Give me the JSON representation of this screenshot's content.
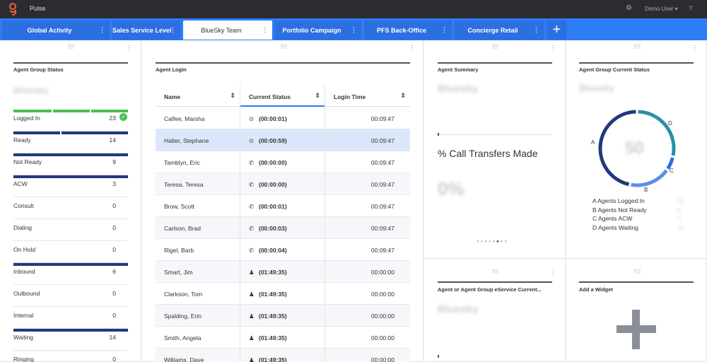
{
  "app": {
    "title": "Pulse",
    "user": "Demo User ▾",
    "help": "?"
  },
  "tabs": [
    {
      "label": "Global Activity",
      "active": false
    },
    {
      "label": "Sales Service Level",
      "active": false
    },
    {
      "label": "BlueSky Team",
      "active": true
    },
    {
      "label": "Portfolio Campaign",
      "active": false
    },
    {
      "label": "PFS Back-Office",
      "active": false
    },
    {
      "label": "Concierge Retail",
      "active": false
    }
  ],
  "tab_menu_glyph": "⋮",
  "add_tab_label": "+",
  "agent_group_status": {
    "title": "Agent Group Status",
    "group": "Bluesky",
    "rows": [
      {
        "label": "Logged In",
        "value": "23",
        "bar": 1.0,
        "color": "#4cbf4f"
      },
      {
        "label": "Ready",
        "value": "14",
        "bar": 1.0,
        "color": "#1f3a7a"
      },
      {
        "label": "Not Ready",
        "value": "9",
        "bar": 1.0,
        "color": "#1f3a7a"
      },
      {
        "label": "ACW",
        "value": "3",
        "bar": 1.0,
        "color": "#1f3a7a"
      },
      {
        "label": "Consult",
        "value": "0",
        "bar": 0,
        "color": "#1f3a7a"
      },
      {
        "label": "Dialing",
        "value": "0",
        "bar": 0,
        "color": "#1f3a7a"
      },
      {
        "label": "On Hold",
        "value": "0",
        "bar": 0,
        "color": "#1f3a7a"
      },
      {
        "label": "Inbound",
        "value": "6",
        "bar": 1.0,
        "color": "#1f3a7a"
      },
      {
        "label": "Outbound",
        "value": "0",
        "bar": 0,
        "color": "#1f3a7a"
      },
      {
        "label": "Internal",
        "value": "0",
        "bar": 0,
        "color": "#1f3a7a"
      },
      {
        "label": "Waiting",
        "value": "14",
        "bar": 1.0,
        "color": "#1f3a7a"
      },
      {
        "label": "Ringing",
        "value": "0",
        "bar": 0,
        "color": "#1f3a7a"
      }
    ]
  },
  "agent_login": {
    "title": "Agent Login",
    "columns": [
      "Name",
      "Current Status",
      "Login Time"
    ],
    "rows": [
      {
        "name": "Calfee, Marsha",
        "icon": "target",
        "status": "(00:00:01)",
        "login": "00:09:47"
      },
      {
        "name": "Halter, Stephane",
        "icon": "target",
        "status": "(00:00:59)",
        "login": "00:09:47"
      },
      {
        "name": "Tamblyn, Eric",
        "icon": "phone",
        "status": "(00:00:00)",
        "login": "00:09:47"
      },
      {
        "name": "Teresa, Teresa",
        "icon": "phone",
        "status": "(00:00:00)",
        "login": "00:09:47"
      },
      {
        "name": "Brow, Scott",
        "icon": "phone",
        "status": "(00:00:01)",
        "login": "00:09:47"
      },
      {
        "name": "Carlson, Brad",
        "icon": "phone",
        "status": "(00:00:03)",
        "login": "00:09:47"
      },
      {
        "name": "Rigel, Barb",
        "icon": "phone",
        "status": "(00:00:04)",
        "login": "00:09:47"
      },
      {
        "name": "Smart, Jim",
        "icon": "person",
        "status": "(01:49:35)",
        "login": "00:00:00"
      },
      {
        "name": "Clarkson, Tom",
        "icon": "person",
        "status": "(01:49:35)",
        "login": "00:00:00"
      },
      {
        "name": "Spalding, Erin",
        "icon": "person",
        "status": "(01:49:35)",
        "login": "00:00:00"
      },
      {
        "name": "Smith, Angela",
        "icon": "person",
        "status": "(01:49:35)",
        "login": "00:00:00"
      },
      {
        "name": "Williams, Dave",
        "icon": "person",
        "status": "(01:49:35)",
        "login": "00:00:00"
      }
    ]
  },
  "agent_summary": {
    "title": "Agent Summary",
    "group": "Bluesky",
    "metric": "% Call Transfers Made",
    "value": "0%",
    "pager_count": 8,
    "pager_active": 5
  },
  "agent_group_current_status": {
    "title": "Agent Group Current Status",
    "group": "Bluesky",
    "total": "50",
    "segments": [
      {
        "letter": "A",
        "label": "Agents Logged In",
        "value": 23,
        "color": "#1f3a7a"
      },
      {
        "letter": "B",
        "label": "Agents Not Ready",
        "value": 9,
        "color": "#5b8fe8"
      },
      {
        "letter": "C",
        "label": "Agents ACW",
        "value": 3,
        "color": "#2a6fd6"
      },
      {
        "letter": "D",
        "label": "Agents Waiting",
        "value": 14,
        "color": "#2a8fa8"
      }
    ]
  },
  "eservice_widget": {
    "title": "Agent or Agent Group eService Current...",
    "group": "Bluesky"
  },
  "add_widget": {
    "title": "Add a Widget"
  }
}
